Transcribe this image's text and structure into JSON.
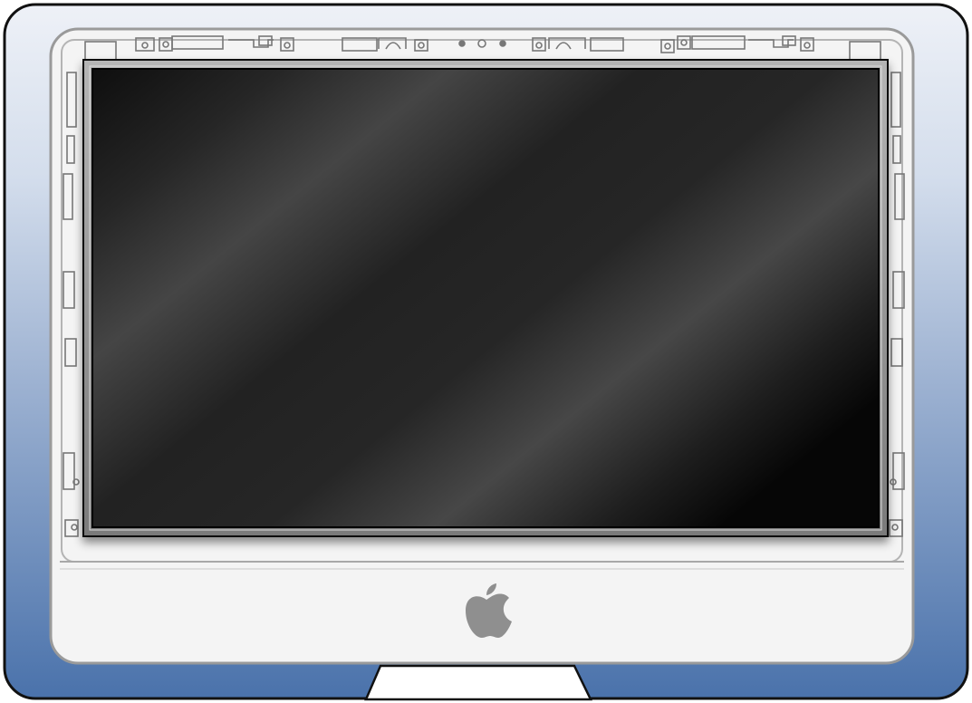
{
  "illustration": {
    "subject": "desktop-computer-with-lcd-panel",
    "logo": "apple-logo-icon",
    "colors": {
      "background_top": "#eef1f7",
      "background_bottom": "#4a72ab",
      "bezel": "#f4f4f4",
      "bezel_outline": "#9a9a9a",
      "panel_frame": "#8c8c8c",
      "screen_dark": "#0c0c0c",
      "screen_light": "#4a4a4a",
      "logo": "#8f8f8f",
      "stand": "#ffffff"
    }
  }
}
